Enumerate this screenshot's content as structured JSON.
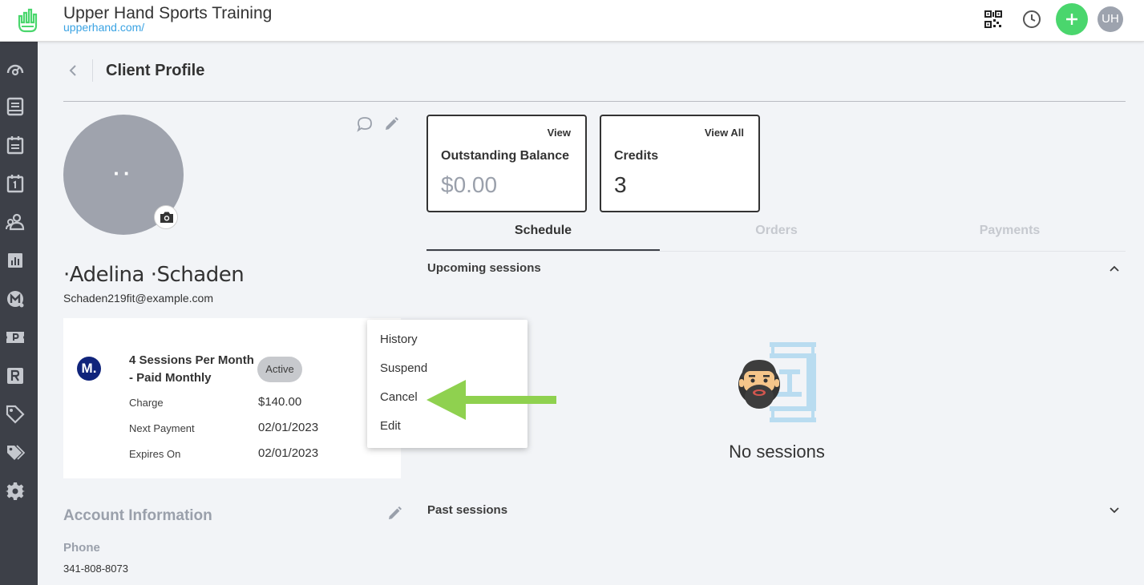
{
  "header": {
    "brand_title": "Upper Hand Sports Training",
    "brand_url": "upperhand.com/",
    "avatar_initials": "UH",
    "icons": [
      "qr-code-icon",
      "clock-icon",
      "plus-icon"
    ],
    "colors": {
      "accent_green": "#4ad66d",
      "link_blue": "#3aa3e3"
    }
  },
  "sidebar": {
    "icons": [
      "dashboard-icon",
      "book-icon",
      "calendar-icon",
      "calendar-day-icon",
      "clients-icon",
      "reports-icon",
      "memberships-icon",
      "passes-icon",
      "resources-icon",
      "tag-icon",
      "tags-icon",
      "settings-icon"
    ],
    "color": "#3d4048"
  },
  "page": {
    "title": "Client Profile"
  },
  "profile": {
    "initials": "··",
    "name": "·Adelina ·Schaden",
    "email": "Schaden219fit@example.com"
  },
  "membership": {
    "logo_letter": "M.",
    "name": "4 Sessions Per Month - Paid Monthly",
    "status": "Active",
    "rows": [
      {
        "label": "Charge",
        "value": "$140.00"
      },
      {
        "label": "Next Payment",
        "value": "02/01/2023"
      },
      {
        "label": "Expires On",
        "value": "02/01/2023"
      }
    ]
  },
  "menu": {
    "items": [
      "History",
      "Suspend",
      "Cancel",
      "Edit"
    ]
  },
  "account": {
    "title": "Account Information",
    "phone_label": "Phone",
    "phone_value": "341-808-8073"
  },
  "cards": {
    "balance": {
      "link": "View",
      "label": "Outstanding Balance",
      "value": "$0.00"
    },
    "credits": {
      "link": "View All",
      "label": "Credits",
      "value": "3"
    }
  },
  "tabs": [
    "Schedule",
    "Orders",
    "Payments"
  ],
  "schedule": {
    "upcoming_title": "Upcoming sessions",
    "empty_text": "No sessions",
    "past_title": "Past sessions"
  }
}
